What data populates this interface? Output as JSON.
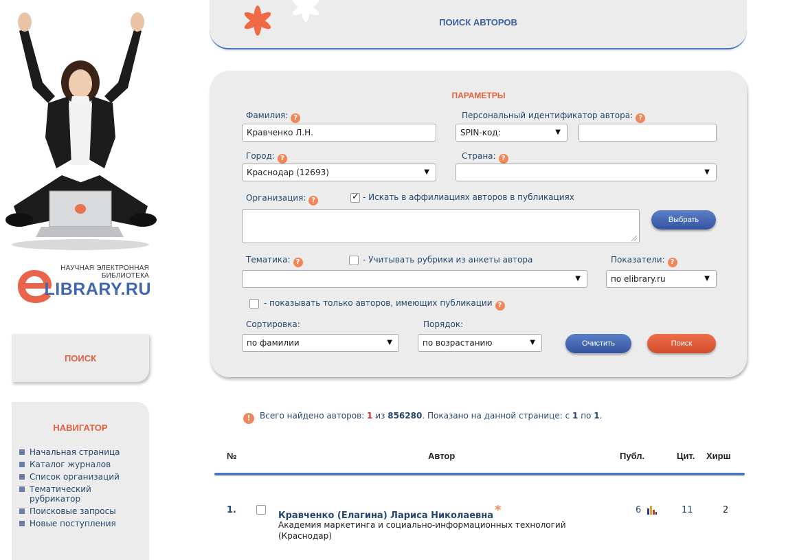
{
  "logo": {
    "caption_line1": "НАУЧНАЯ ЭЛЕКТРОННАЯ",
    "caption_line2": "БИБЛИОТЕКА",
    "wordmark": "LIBRARY.RU"
  },
  "left_search": {
    "label": "ПОИСК"
  },
  "navigator": {
    "title": "НАВИГАТОР",
    "items": [
      "Начальная страница",
      "Каталог журналов",
      "Список организаций",
      "Тематический рубрикатор",
      "Поисковые запросы",
      "Новые поступления"
    ]
  },
  "header": {
    "title": "ПОИСК АВТОРОВ"
  },
  "params": {
    "title": "ПАРАМЕТРЫ",
    "surname_label": "Фамилия:",
    "surname_value": "Кравченко Л.Н.",
    "personal_id_label": "Персональный идентификатор автора:",
    "id_type_value": "SPIN-код:",
    "id_value": "",
    "city_label": "Город:",
    "city_value": "Краснодар  (12693)",
    "country_label": "Страна:",
    "country_value": "",
    "org_label": "Организация:",
    "affil_checkbox_label": "- Искать в аффилиациях авторов в публикациях",
    "affil_checked": true,
    "org_value": "",
    "choose_button": "Выбрать",
    "topic_label": "Тематика:",
    "topic_checkbox_label": "- Учитывать рубрики из анкеты автора",
    "topic_checked": false,
    "topic_value": "",
    "indicators_label": "Показатели:",
    "indicators_value": "по elibrary.ru",
    "only_pubs_label": "- показывать только авторов, имеющих публикации",
    "only_pubs_checked": false,
    "sort_label": "Сортировка:",
    "sort_value": "по фамилии",
    "order_label": "Порядок:",
    "order_value": "по возрастанию",
    "clear_button": "Очистить",
    "search_button": "Поиск"
  },
  "results": {
    "found_prefix": "Всего найдено авторов:",
    "found_count": "1",
    "found_of": "из",
    "found_total": "856280",
    "shown_prefix": ". Показано на данной странице: с",
    "shown_from": "1",
    "shown_to_word": "по",
    "shown_to": "1",
    "columns": {
      "num": "№",
      "author": "Автор",
      "pubs": "Публ.",
      "cites": "Цит.",
      "hirsch": "Хирш"
    },
    "rows": [
      {
        "num": "1.",
        "name": "Кравченко (Елагина) Лариса Николаевна",
        "star": "*",
        "affiliation": "Академия маркетинга и социально-информационных технологий (Краснодар)",
        "pubs": "6",
        "cites": "11",
        "hirsch": "2"
      }
    ]
  },
  "colors": {
    "accent_orange": "#e2613f",
    "link_blue": "#25476e",
    "rule_blue": "#4a75c2",
    "panel_gray": "#ececec"
  }
}
